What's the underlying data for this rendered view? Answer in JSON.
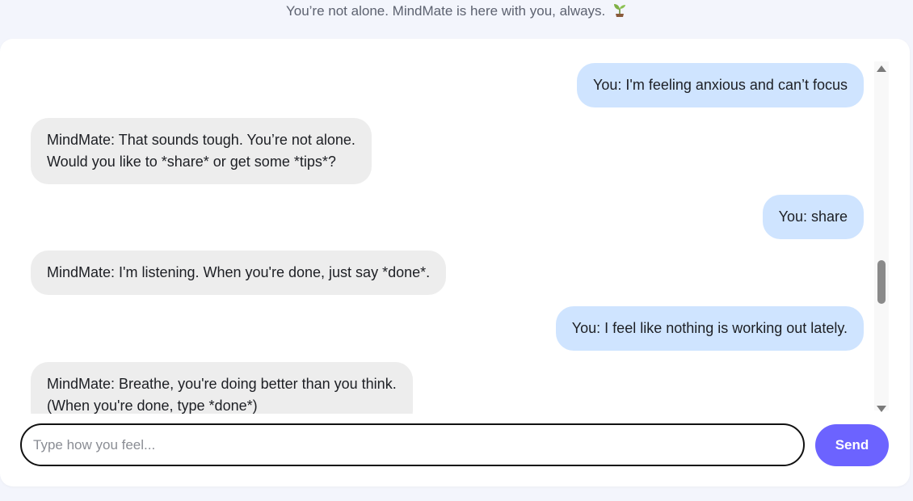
{
  "tagline": {
    "text": "You’re not alone. MindMate is here with you, always.",
    "icon": "sprout-icon"
  },
  "messages": [
    {
      "role": "user",
      "line1": "You: I'm feeling anxious and can’t focus",
      "line2": ""
    },
    {
      "role": "bot",
      "line1": "MindMate: That sounds tough. You’re not alone.",
      "line2": "Would you like to *share* or get some *tips*?"
    },
    {
      "role": "user",
      "line1": "You: share",
      "line2": ""
    },
    {
      "role": "bot",
      "line1": "MindMate: I'm listening. When you're done, just say *done*.",
      "line2": ""
    },
    {
      "role": "user",
      "line1": "You: I feel like nothing is working out lately.",
      "line2": ""
    },
    {
      "role": "bot",
      "line1": "MindMate: Breathe, you're doing better than you think.",
      "line2": "(When you're done, type *done*)"
    }
  ],
  "input": {
    "placeholder": "Type how you feel...",
    "value": ""
  },
  "send_button": {
    "label": "Send"
  },
  "colors": {
    "user_bubble": "#cfe4ff",
    "bot_bubble": "#ededed",
    "accent": "#6c63ff",
    "background": "#f3f5fc"
  }
}
